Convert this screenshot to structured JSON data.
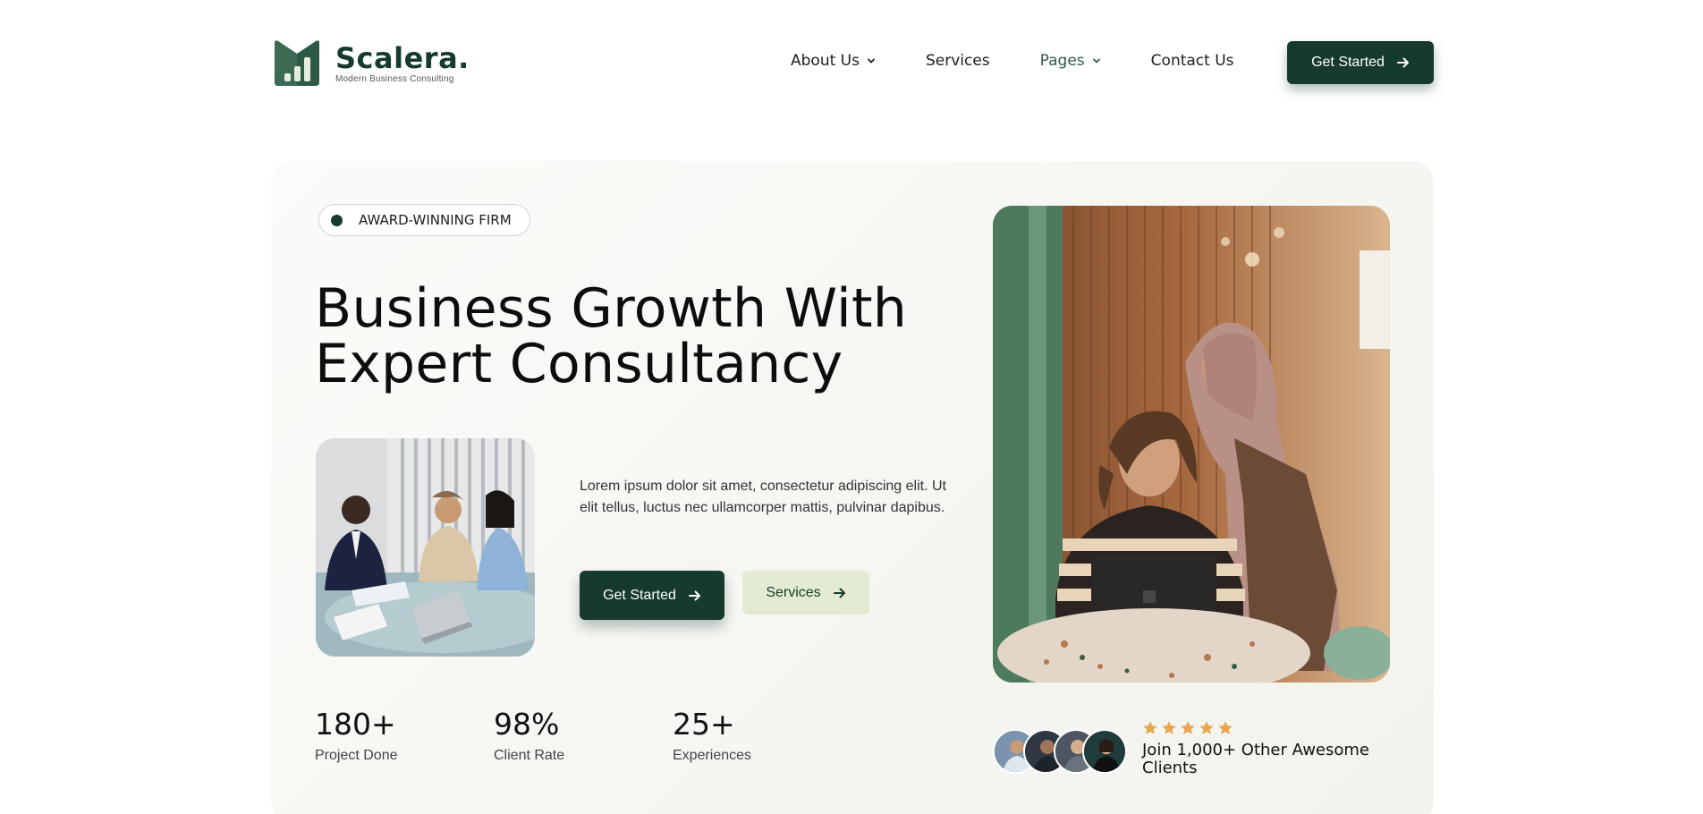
{
  "brand": {
    "name": "Scalera.",
    "tagline": "Modern Business Consulting",
    "color": "#163a2c"
  },
  "nav": {
    "items": [
      {
        "label": "About Us",
        "has_dropdown": true,
        "active": false
      },
      {
        "label": "Services",
        "has_dropdown": false,
        "active": false
      },
      {
        "label": "Pages",
        "has_dropdown": true,
        "active": true
      },
      {
        "label": "Contact Us",
        "has_dropdown": false,
        "active": false
      }
    ],
    "cta_label": "Get Started"
  },
  "hero": {
    "badge": "AWARD-WINNING FIRM",
    "headline_line1": "Business Growth With",
    "headline_line2": "Expert Consultancy",
    "description": "Lorem ipsum dolor sit amet, consectetur adipiscing elit. Ut elit tellus, luctus nec ullamcorper mattis, pulvinar dapibus.",
    "primary_button": "Get Started",
    "secondary_button": "Services"
  },
  "stats": [
    {
      "value": "180+",
      "label": "Project Done"
    },
    {
      "value": "98%",
      "label": "Client Rate"
    },
    {
      "value": "25+",
      "label": "Experiences"
    }
  ],
  "social_proof": {
    "stars": 5,
    "star_color": "#e8a54b",
    "text": "Join 1,000+ Other Awesome Clients"
  },
  "colors": {
    "accent_dark": "#163a2c",
    "accent_light": "#e3ecd2",
    "hero_bg": "#f5f5f1"
  }
}
